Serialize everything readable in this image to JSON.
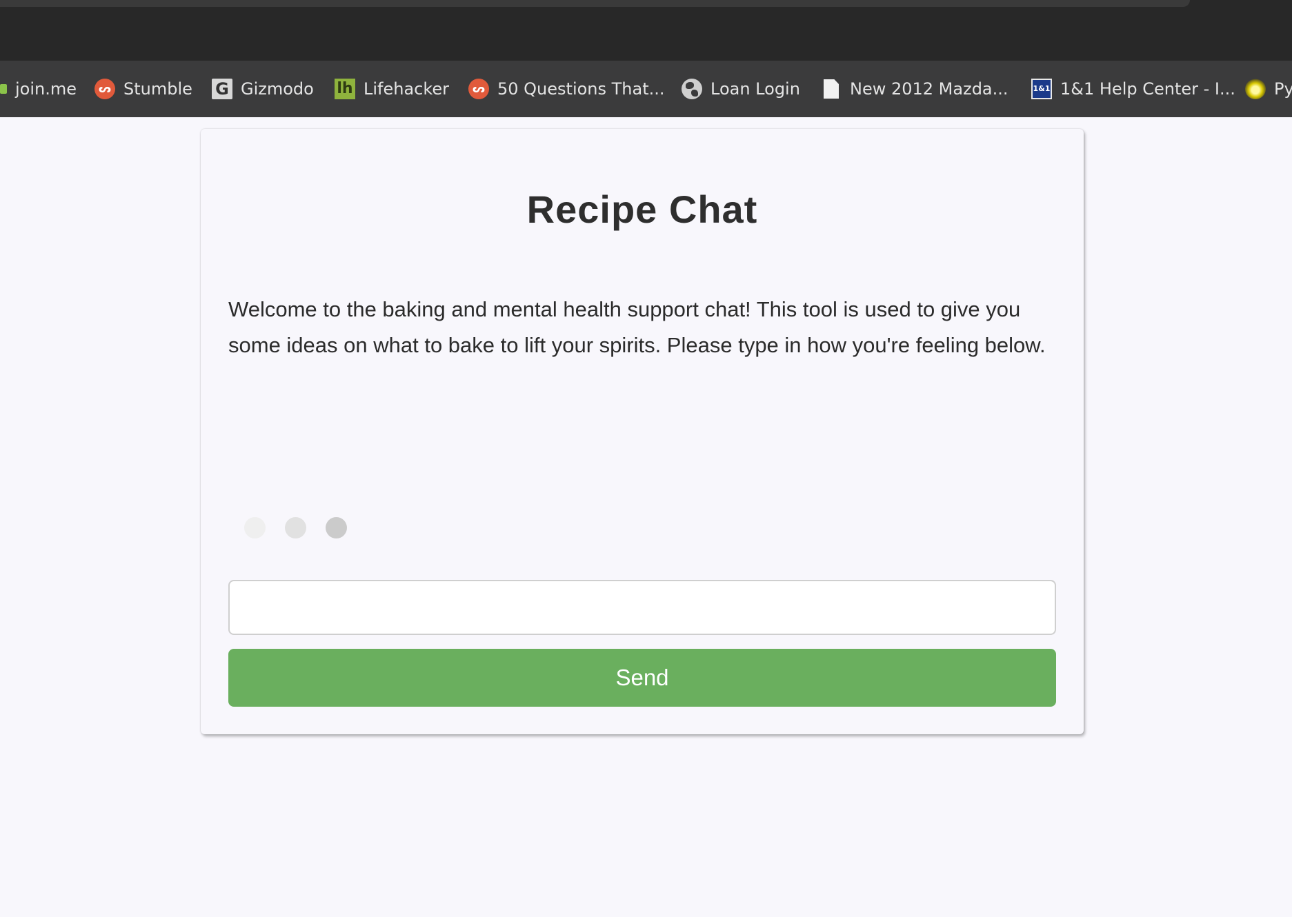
{
  "bookmarks": [
    {
      "label": "join.me",
      "icon": "joinme-icon"
    },
    {
      "label": "Stumble",
      "icon": "stumbleupon-icon"
    },
    {
      "label": "Gizmodo",
      "icon": "gizmodo-icon",
      "glyph": "G"
    },
    {
      "label": "Lifehacker",
      "icon": "lifehacker-icon",
      "glyph": "lh"
    },
    {
      "label": "50 Questions That...",
      "icon": "stumbleupon-icon"
    },
    {
      "label": "Loan Login",
      "icon": "globe-icon"
    },
    {
      "label": "New 2012 Mazda...",
      "icon": "document-icon"
    },
    {
      "label": "1&1 Help Center - I...",
      "icon": "oneandone-icon",
      "glyph": "1&1"
    },
    {
      "label": "Py",
      "icon": "bulb-icon"
    }
  ],
  "chat": {
    "title": "Recipe Chat",
    "intro": "Welcome to the baking and mental health support chat! This tool is used to give you some ideas on what to bake to lift your spirits. Please type in how you're feeling below.",
    "typing_dot_colors": [
      "#efefef",
      "#e1e1e1",
      "#cbcbcb"
    ],
    "input": {
      "value": "",
      "placeholder": ""
    },
    "send_label": "Send"
  },
  "colors": {
    "accent": "#6aaf5e",
    "page_background": "#f8f7fc",
    "bookmarks_bar": "#3b3b3c",
    "title_text": "#2e2e2e"
  }
}
